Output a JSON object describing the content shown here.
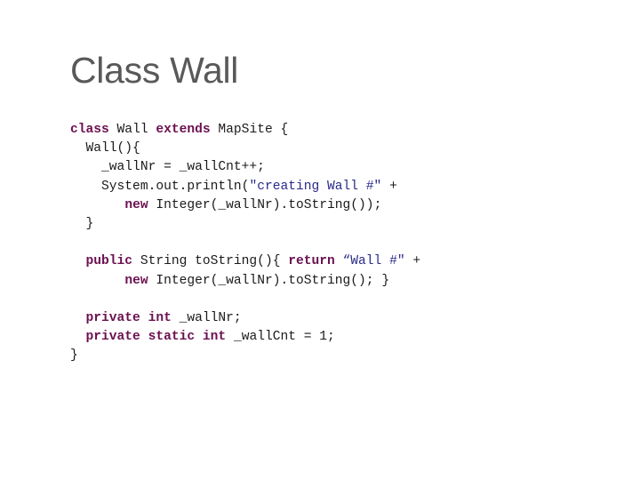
{
  "slide": {
    "title": "Class Wall",
    "code_lines": [
      [
        {
          "t": "kw",
          "v": "class"
        },
        {
          "t": "p",
          "v": " Wall "
        },
        {
          "t": "kw",
          "v": "extends"
        },
        {
          "t": "p",
          "v": " MapSite {"
        }
      ],
      [
        {
          "t": "p",
          "v": "  Wall(){"
        }
      ],
      [
        {
          "t": "p",
          "v": "    _wallNr = _wallCnt++;"
        }
      ],
      [
        {
          "t": "p",
          "v": "    System.out.println("
        },
        {
          "t": "str",
          "v": "\"creating Wall #\""
        },
        {
          "t": "p",
          "v": " +"
        }
      ],
      [
        {
          "t": "p",
          "v": "       "
        },
        {
          "t": "kw",
          "v": "new"
        },
        {
          "t": "p",
          "v": " Integer(_wallNr).toString());"
        }
      ],
      [
        {
          "t": "p",
          "v": "  }"
        }
      ],
      [],
      [
        {
          "t": "p",
          "v": "  "
        },
        {
          "t": "kw",
          "v": "public"
        },
        {
          "t": "p",
          "v": " String toString(){ "
        },
        {
          "t": "kw",
          "v": "return"
        },
        {
          "t": "p",
          "v": " "
        },
        {
          "t": "str",
          "v": "“Wall #\""
        },
        {
          "t": "p",
          "v": " +"
        }
      ],
      [
        {
          "t": "p",
          "v": "       "
        },
        {
          "t": "kw",
          "v": "new"
        },
        {
          "t": "p",
          "v": " Integer(_wallNr).toString(); }"
        }
      ],
      [],
      [
        {
          "t": "p",
          "v": "  "
        },
        {
          "t": "kw",
          "v": "private"
        },
        {
          "t": "p",
          "v": " "
        },
        {
          "t": "kw",
          "v": "int"
        },
        {
          "t": "p",
          "v": " _wallNr;"
        }
      ],
      [
        {
          "t": "p",
          "v": "  "
        },
        {
          "t": "kw",
          "v": "private"
        },
        {
          "t": "p",
          "v": " "
        },
        {
          "t": "kw",
          "v": "static"
        },
        {
          "t": "p",
          "v": " "
        },
        {
          "t": "kw",
          "v": "int"
        },
        {
          "t": "p",
          "v": " _wallCnt = 1;"
        }
      ],
      [
        {
          "t": "p",
          "v": "}"
        }
      ]
    ]
  },
  "colors": {
    "title": "#595959",
    "keyword": "#6b1050",
    "string": "#2a2a8a",
    "text": "#1a1a1a"
  }
}
